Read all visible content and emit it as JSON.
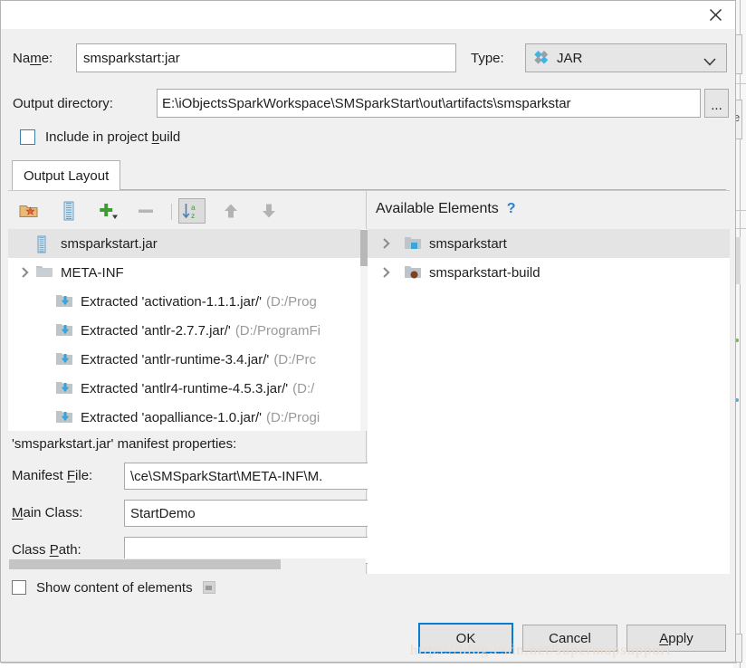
{
  "window": {
    "close_icon": "close-icon"
  },
  "form": {
    "name_label": "Name:",
    "name_label_pre": "Na",
    "name_label_mnemonic": "m",
    "name_label_post": "e:",
    "name_value": "smsparkstart:jar",
    "type_label": "Type:",
    "type_value": "JAR",
    "type_icon": "artifact-diamonds-icon",
    "type_arrow_icon": "chevron-down-icon",
    "output_label": "Output directory:",
    "output_value": "E:\\iObjectsSparkWorkspace\\SMSparkStart\\out\\artifacts\\smsparkstar",
    "browse_label": "...",
    "include_label_pre": "Include in project ",
    "include_label_mnemonic": "b",
    "include_label_post": "uild",
    "include_checked": false
  },
  "tabs": [
    {
      "label": "Output Layout",
      "active": true
    }
  ],
  "toolbar": {
    "buttons": [
      {
        "name": "add-directory-icon",
        "label": "",
        "state": "normal"
      },
      {
        "name": "add-archive-icon",
        "label": "",
        "state": "normal"
      },
      {
        "name": "add-plus-icon",
        "label": "",
        "state": "normal"
      },
      {
        "name": "remove-minus-icon",
        "label": "",
        "state": "disabled"
      },
      {
        "name": "sort-alphabetically-icon",
        "label": "",
        "state": "pressed"
      },
      {
        "name": "move-up-icon",
        "label": "",
        "state": "normal"
      },
      {
        "name": "move-down-icon",
        "label": "",
        "state": "normal"
      }
    ]
  },
  "output_tree": {
    "rows": [
      {
        "icon": "archive-jar-icon",
        "twisty": "",
        "label": "smsparkstart.jar",
        "path": "",
        "selected": true,
        "indent": 0
      },
      {
        "icon": "folder-icon",
        "twisty": "▸",
        "label": "META-INF",
        "path": "",
        "selected": false,
        "indent": 0
      },
      {
        "icon": "extracted-icon",
        "twisty": "",
        "label": "Extracted 'activation-1.1.1.jar/'",
        "path": "(D:/Prog",
        "selected": false,
        "indent": 1
      },
      {
        "icon": "extracted-icon",
        "twisty": "",
        "label": "Extracted 'antlr-2.7.7.jar/'",
        "path": "(D:/ProgramFi",
        "selected": false,
        "indent": 1
      },
      {
        "icon": "extracted-icon",
        "twisty": "",
        "label": "Extracted 'antlr-runtime-3.4.jar/'",
        "path": "(D:/Prc",
        "selected": false,
        "indent": 1
      },
      {
        "icon": "extracted-icon",
        "twisty": "",
        "label": "Extracted 'antlr4-runtime-4.5.3.jar/'",
        "path": "(D:/",
        "selected": false,
        "indent": 1
      },
      {
        "icon": "extracted-icon",
        "twisty": "",
        "label": "Extracted 'aopalliance-1.0.jar/'",
        "path": "(D:/Progi",
        "selected": false,
        "indent": 1
      }
    ]
  },
  "manifest": {
    "title": "'smsparkstart.jar' manifest properties:",
    "fields": [
      {
        "label_pre": "Manifest ",
        "label_mnemonic": "F",
        "label_post": "ile:",
        "value": "\\ce\\SMSparkStart\\META-INF\\M."
      },
      {
        "label_pre": "",
        "label_mnemonic": "M",
        "label_post": "ain Class:",
        "value": "StartDemo"
      },
      {
        "label_pre": "Class ",
        "label_mnemonic": "P",
        "label_post": "ath:",
        "value": ""
      }
    ]
  },
  "available": {
    "title": "Available Elements",
    "help_icon": "help-question-icon",
    "rows": [
      {
        "twisty": "▸",
        "icon": "module-blue-icon",
        "label": "smsparkstart",
        "selected": true
      },
      {
        "twisty": "▸",
        "icon": "module-brown-icon",
        "label": "smsparkstart-build",
        "selected": false
      }
    ]
  },
  "footer": {
    "show_content_label": "Show content of elements",
    "show_content_checked": false,
    "show_content_icon": "content-preview-icon",
    "ok_label": "OK",
    "cancel_label": "Cancel",
    "apply_label_mnemonic": "A",
    "apply_label_post": "pply"
  },
  "watermark": {
    "text": "https://blog.csdn.net/supermapsupport"
  },
  "colors": {
    "accent_blue": "#0a7bd3",
    "dialog_bg": "#f0f0f0",
    "field_bg": "#ffffff",
    "selection_gray": "#e4e4e4",
    "path_gray": "#9a9a9a"
  }
}
